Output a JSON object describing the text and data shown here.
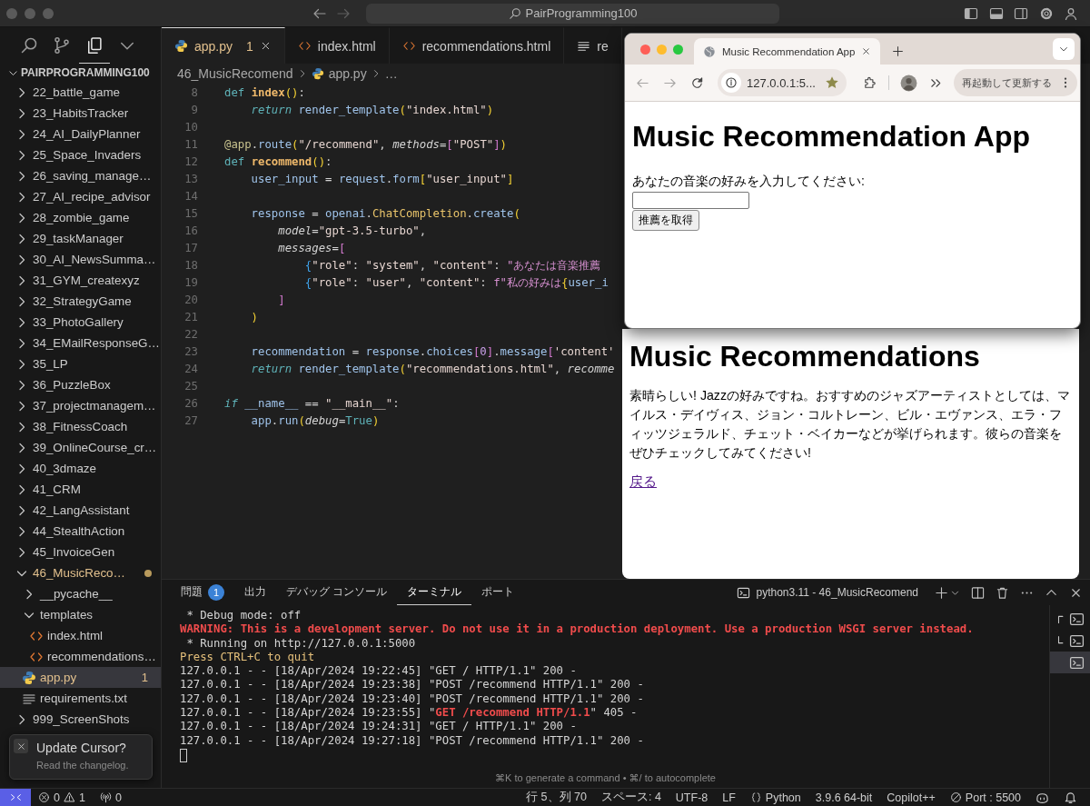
{
  "titlebar": {
    "search": "PairProgramming100"
  },
  "activity": [
    {
      "kind": "search",
      "selected": false
    },
    {
      "kind": "branch",
      "selected": false
    },
    {
      "kind": "files",
      "selected": true
    },
    {
      "kind": "more",
      "selected": false
    }
  ],
  "explorer": {
    "title": "PAIRPROGRAMMING100",
    "expanded": true,
    "items": [
      {
        "label": "22_battle_game",
        "kind": "folder",
        "expanded": false,
        "selected": false
      },
      {
        "label": "23_HabitsTracker",
        "kind": "folder",
        "expanded": false,
        "selected": false
      },
      {
        "label": "24_AI_DailyPlanner",
        "kind": "folder",
        "expanded": false,
        "selected": false
      },
      {
        "label": "25_Space_Invaders",
        "kind": "folder",
        "expanded": false,
        "selected": false
      },
      {
        "label": "26_saving_manage…",
        "kind": "folder",
        "expanded": false,
        "selected": false
      },
      {
        "label": "27_AI_recipe_advisor",
        "kind": "folder",
        "expanded": false,
        "selected": false
      },
      {
        "label": "28_zombie_game",
        "kind": "folder",
        "expanded": false,
        "selected": false
      },
      {
        "label": "29_taskManager",
        "kind": "folder",
        "expanded": false,
        "selected": false
      },
      {
        "label": "30_AI_NewsSumma…",
        "kind": "folder",
        "expanded": false,
        "selected": false
      },
      {
        "label": "31_GYM_createxyz",
        "kind": "folder",
        "expanded": false,
        "selected": false
      },
      {
        "label": "32_StrategyGame",
        "kind": "folder",
        "expanded": false,
        "selected": false
      },
      {
        "label": "33_PhotoGallery",
        "kind": "folder",
        "expanded": false,
        "selected": false
      },
      {
        "label": "34_EMailResponseG…",
        "kind": "folder",
        "expanded": false,
        "selected": false
      },
      {
        "label": "35_LP",
        "kind": "folder",
        "expanded": false,
        "selected": false
      },
      {
        "label": "36_PuzzleBox",
        "kind": "folder",
        "expanded": false,
        "selected": false
      },
      {
        "label": "37_projectmanagem…",
        "kind": "folder",
        "expanded": false,
        "selected": false
      },
      {
        "label": "38_FitnessCoach",
        "kind": "folder",
        "expanded": false,
        "selected": false
      },
      {
        "label": "39_OnlineCourse_cr…",
        "kind": "folder",
        "expanded": false,
        "selected": false
      },
      {
        "label": "40_3dmaze",
        "kind": "folder",
        "expanded": false,
        "selected": false
      },
      {
        "label": "41_CRM",
        "kind": "folder",
        "expanded": false,
        "selected": false
      },
      {
        "label": "42_LangAssistant",
        "kind": "folder",
        "expanded": false,
        "selected": false
      },
      {
        "label": "44_StealthAction",
        "kind": "folder",
        "expanded": false,
        "selected": false
      },
      {
        "label": "45_InvoiceGen",
        "kind": "folder",
        "expanded": false,
        "selected": false
      },
      {
        "label": "46_MusicReco…",
        "kind": "folder",
        "expanded": true,
        "selected": false,
        "warning": true,
        "children": [
          {
            "label": "__pycache__",
            "kind": "folder",
            "expanded": false,
            "selected": false
          },
          {
            "label": "templates",
            "kind": "folder",
            "expanded": true,
            "selected": false,
            "children": [
              {
                "label": "index.html",
                "kind": "html",
                "selected": false
              },
              {
                "label": "recommendations…",
                "kind": "html",
                "selected": false
              }
            ]
          },
          {
            "label": "app.py",
            "kind": "python",
            "selected": true,
            "warning": true,
            "badge": "1"
          },
          {
            "label": "requirements.txt",
            "kind": "text",
            "selected": false
          }
        ]
      },
      {
        "label": "999_ScreenShots",
        "kind": "folder",
        "expanded": false,
        "selected": false
      }
    ]
  },
  "toast": {
    "title": "Update Cursor?",
    "text": "Read the changelog."
  },
  "tabs": [
    {
      "label": "app.py",
      "kind": "python",
      "selected": true,
      "warning": true,
      "badge": "1"
    },
    {
      "label": "index.html",
      "kind": "html",
      "selected": false
    },
    {
      "label": "recommendations.html",
      "kind": "html",
      "selected": false
    },
    {
      "label": "re",
      "kind": "text",
      "selected": false
    }
  ],
  "breadcrumb": {
    "folder": "46_MusicRecomend",
    "file": "app.py",
    "more": "…"
  },
  "code": [
    {
      "n": "8",
      "tokens": [
        {
          "kind": "kw",
          "text": "def "
        },
        {
          "kind": "fn",
          "text": "index"
        },
        {
          "kind": "br1",
          "text": "()"
        },
        {
          "kind": "plain",
          "text": ":"
        }
      ]
    },
    {
      "n": "9",
      "tokens": [
        {
          "kind": "ikw",
          "text": "    return "
        },
        {
          "kind": "var",
          "text": "render_template"
        },
        {
          "kind": "br1",
          "text": "("
        },
        {
          "kind": "str",
          "text": "\"index.html\""
        },
        {
          "kind": "br1",
          "text": ")"
        }
      ]
    },
    {
      "n": "10"
    },
    {
      "n": "11",
      "tokens": [
        {
          "kind": "dec",
          "text": "@app"
        },
        {
          "kind": "plain",
          "text": "."
        },
        {
          "kind": "var",
          "text": "route"
        },
        {
          "kind": "br1",
          "text": "("
        },
        {
          "kind": "str",
          "text": "\"/recommend\""
        },
        {
          "kind": "plain",
          "text": ", "
        },
        {
          "kind": "param",
          "text": "methods"
        },
        {
          "kind": "plain",
          "text": "="
        },
        {
          "kind": "br2",
          "text": "["
        },
        {
          "kind": "str",
          "text": "\"POST\""
        },
        {
          "kind": "br2",
          "text": "]"
        },
        {
          "kind": "br1",
          "text": ")"
        }
      ]
    },
    {
      "n": "12",
      "tokens": [
        {
          "kind": "kw",
          "text": "def "
        },
        {
          "kind": "fn",
          "text": "recommend"
        },
        {
          "kind": "br1",
          "text": "()"
        },
        {
          "kind": "plain",
          "text": ":"
        }
      ]
    },
    {
      "n": "13",
      "tokens": [
        {
          "kind": "var",
          "text": "    user_input"
        },
        {
          "kind": "plain",
          "text": " = "
        },
        {
          "kind": "var",
          "text": "request"
        },
        {
          "kind": "plain",
          "text": "."
        },
        {
          "kind": "var",
          "text": "form"
        },
        {
          "kind": "br1",
          "text": "["
        },
        {
          "kind": "str",
          "text": "\"user_input\""
        },
        {
          "kind": "br1",
          "text": "]"
        }
      ]
    },
    {
      "n": "14"
    },
    {
      "n": "15",
      "tokens": [
        {
          "kind": "var",
          "text": "    response"
        },
        {
          "kind": "plain",
          "text": " = "
        },
        {
          "kind": "var",
          "text": "openai"
        },
        {
          "kind": "plain",
          "text": "."
        },
        {
          "kind": "cls",
          "text": "ChatCompletion"
        },
        {
          "kind": "plain",
          "text": "."
        },
        {
          "kind": "var",
          "text": "create"
        },
        {
          "kind": "br1",
          "text": "("
        }
      ]
    },
    {
      "n": "16",
      "tokens": [
        {
          "kind": "param",
          "text": "        model"
        },
        {
          "kind": "plain",
          "text": "="
        },
        {
          "kind": "str",
          "text": "\"gpt-3.5-turbo\""
        },
        {
          "kind": "plain",
          "text": ","
        }
      ]
    },
    {
      "n": "17",
      "tokens": [
        {
          "kind": "param",
          "text": "        messages"
        },
        {
          "kind": "plain",
          "text": "="
        },
        {
          "kind": "br2",
          "text": "["
        }
      ]
    },
    {
      "n": "18",
      "tokens": [
        {
          "kind": "br3",
          "text": "            {"
        },
        {
          "kind": "str",
          "text": "\"role\""
        },
        {
          "kind": "plain",
          "text": ": "
        },
        {
          "kind": "str",
          "text": "\"system\""
        },
        {
          "kind": "plain",
          "text": ", "
        },
        {
          "kind": "str",
          "text": "\"content\""
        },
        {
          "kind": "plain",
          "text": ": "
        },
        {
          "kind": "str2",
          "text": "\"あなたは音楽推薦"
        }
      ]
    },
    {
      "n": "19",
      "tokens": [
        {
          "kind": "br3",
          "text": "            {"
        },
        {
          "kind": "str",
          "text": "\"role\""
        },
        {
          "kind": "plain",
          "text": ": "
        },
        {
          "kind": "str",
          "text": "\"user\""
        },
        {
          "kind": "plain",
          "text": ", "
        },
        {
          "kind": "str",
          "text": "\"content\""
        },
        {
          "kind": "plain",
          "text": ": "
        },
        {
          "kind": "str2",
          "text": "f\"私の好みは"
        },
        {
          "kind": "br1",
          "text": "{"
        },
        {
          "kind": "var",
          "text": "user_i"
        }
      ]
    },
    {
      "n": "20",
      "tokens": [
        {
          "kind": "br2",
          "text": "        ]"
        }
      ]
    },
    {
      "n": "21",
      "tokens": [
        {
          "kind": "br1",
          "text": "    )"
        }
      ]
    },
    {
      "n": "22"
    },
    {
      "n": "23",
      "tokens": [
        {
          "kind": "var",
          "text": "    recommendation"
        },
        {
          "kind": "plain",
          "text": " = "
        },
        {
          "kind": "var",
          "text": "response"
        },
        {
          "kind": "plain",
          "text": "."
        },
        {
          "kind": "var",
          "text": "choices"
        },
        {
          "kind": "br2",
          "text": "["
        },
        {
          "kind": "num",
          "text": "0"
        },
        {
          "kind": "br2",
          "text": "]"
        },
        {
          "kind": "plain",
          "text": "."
        },
        {
          "kind": "var",
          "text": "message"
        },
        {
          "kind": "br2",
          "text": "["
        },
        {
          "kind": "str",
          "text": "'content'"
        }
      ]
    },
    {
      "n": "24",
      "tokens": [
        {
          "kind": "ikw",
          "text": "    return "
        },
        {
          "kind": "var",
          "text": "render_template"
        },
        {
          "kind": "br1",
          "text": "("
        },
        {
          "kind": "str",
          "text": "\"recommendations.html\""
        },
        {
          "kind": "plain",
          "text": ", "
        },
        {
          "kind": "param",
          "text": "recomme"
        }
      ]
    },
    {
      "n": "25"
    },
    {
      "n": "26",
      "tokens": [
        {
          "kind": "ikw",
          "text": "if "
        },
        {
          "kind": "var",
          "text": "__name__"
        },
        {
          "kind": "plain",
          "text": " == "
        },
        {
          "kind": "str",
          "text": "\"__main__\""
        },
        {
          "kind": "plain",
          "text": ":"
        }
      ]
    },
    {
      "n": "27",
      "tokens": [
        {
          "kind": "var",
          "text": "    app"
        },
        {
          "kind": "plain",
          "text": "."
        },
        {
          "kind": "var",
          "text": "run"
        },
        {
          "kind": "br1",
          "text": "("
        },
        {
          "kind": "param",
          "text": "debug"
        },
        {
          "kind": "plain",
          "text": "="
        },
        {
          "kind": "kw",
          "text": "True"
        },
        {
          "kind": "br1",
          "text": ")"
        }
      ]
    }
  ],
  "result_window": {
    "title": "Music Recommendations",
    "text": "素晴らしい! Jazzの好みですね。おすすめのジャズアーティストとしては、マイルス・デイヴィス、ジョン・コルトレーン、ビル・エヴァンス、エラ・フィッツジェラルド、チェット・ベイカーなどが挙げられます。彼らの音楽をぜひチェックしてみてください!",
    "link": "戻る"
  },
  "browser_window": {
    "tab_title": "Music Recommendation App",
    "url": "127.0.0.1:5...",
    "update_button": "再起動して更新する",
    "page": {
      "title": "Music Recommendation App",
      "label": "あなたの音楽の好みを入力してください:",
      "button": "推薦を取得"
    }
  },
  "panel": {
    "tabs": [
      {
        "label": "問題",
        "badge": "1",
        "selected": false
      },
      {
        "label": "出力",
        "selected": false
      },
      {
        "label": "デバッグ コンソール",
        "selected": false
      },
      {
        "label": "ターミナル",
        "selected": true
      },
      {
        "label": "ポート",
        "selected": false
      }
    ],
    "terminal_title": "python3.11 - 46_MusicRecomend",
    "lines": [
      {
        "parts": [
          {
            "kind": "plain",
            "text": " * Debug mode: off"
          }
        ]
      },
      {
        "parts": [
          {
            "kind": "error",
            "text": "WARNING: This is a development server. Do not use it in a production deployment. Use a production WSGI server instead."
          }
        ]
      },
      {
        "parts": [
          {
            "kind": "plain",
            "text": " * Running on http://127.0.0.1:5000"
          }
        ]
      },
      {
        "parts": [
          {
            "kind": "warn",
            "text": "Press CTRL+C to quit"
          }
        ]
      },
      {
        "parts": [
          {
            "kind": "plain",
            "text": "127.0.0.1 - - [18/Apr/2024 19:22:45] \"GET / HTTP/1.1\" 200 -"
          }
        ]
      },
      {
        "parts": [
          {
            "kind": "plain",
            "text": "127.0.0.1 - - [18/Apr/2024 19:23:38] \"POST /recommend HTTP/1.1\" 200 -"
          }
        ]
      },
      {
        "parts": [
          {
            "kind": "plain",
            "text": "127.0.0.1 - - [18/Apr/2024 19:23:40] \"POST /recommend HTTP/1.1\" 200 -"
          }
        ]
      },
      {
        "parts": [
          {
            "kind": "plain",
            "text": "127.0.0.1 - - [18/Apr/2024 19:23:55] \""
          },
          {
            "kind": "error",
            "text": "GET /recommend HTTP/1.1"
          },
          {
            "kind": "plain",
            "text": "\" 405 -"
          }
        ]
      },
      {
        "parts": [
          {
            "kind": "plain",
            "text": "127.0.0.1 - - [18/Apr/2024 19:24:31] \"GET / HTTP/1.1\" 200 -"
          }
        ]
      },
      {
        "parts": [
          {
            "kind": "plain",
            "text": "127.0.0.1 - - [18/Apr/2024 19:27:18] \"POST /recommend HTTP/1.1\" 200 -"
          }
        ]
      }
    ],
    "cursor": true,
    "hint": "⌘K to generate a command • ⌘/ to autocomplete",
    "terminals": [
      {
        "kind": "group-start",
        "selected": false
      },
      {
        "kind": "group-end",
        "selected": false
      },
      {
        "kind": "single",
        "selected": true
      }
    ]
  },
  "status_bar": {
    "errors": "0",
    "warnings": "1",
    "ports": "0",
    "items": [
      {
        "kind": "text",
        "text": "行 5、列 70"
      },
      {
        "kind": "text",
        "text": "スペース: 4"
      },
      {
        "kind": "text",
        "text": "UTF-8"
      },
      {
        "kind": "text",
        "text": "LF"
      },
      {
        "kind": "language",
        "text": "Python"
      },
      {
        "kind": "text",
        "text": "3.9.6 64-bit"
      },
      {
        "kind": "text",
        "text": "Copilot++"
      },
      {
        "kind": "port",
        "text": "Port : 5500"
      }
    ]
  }
}
